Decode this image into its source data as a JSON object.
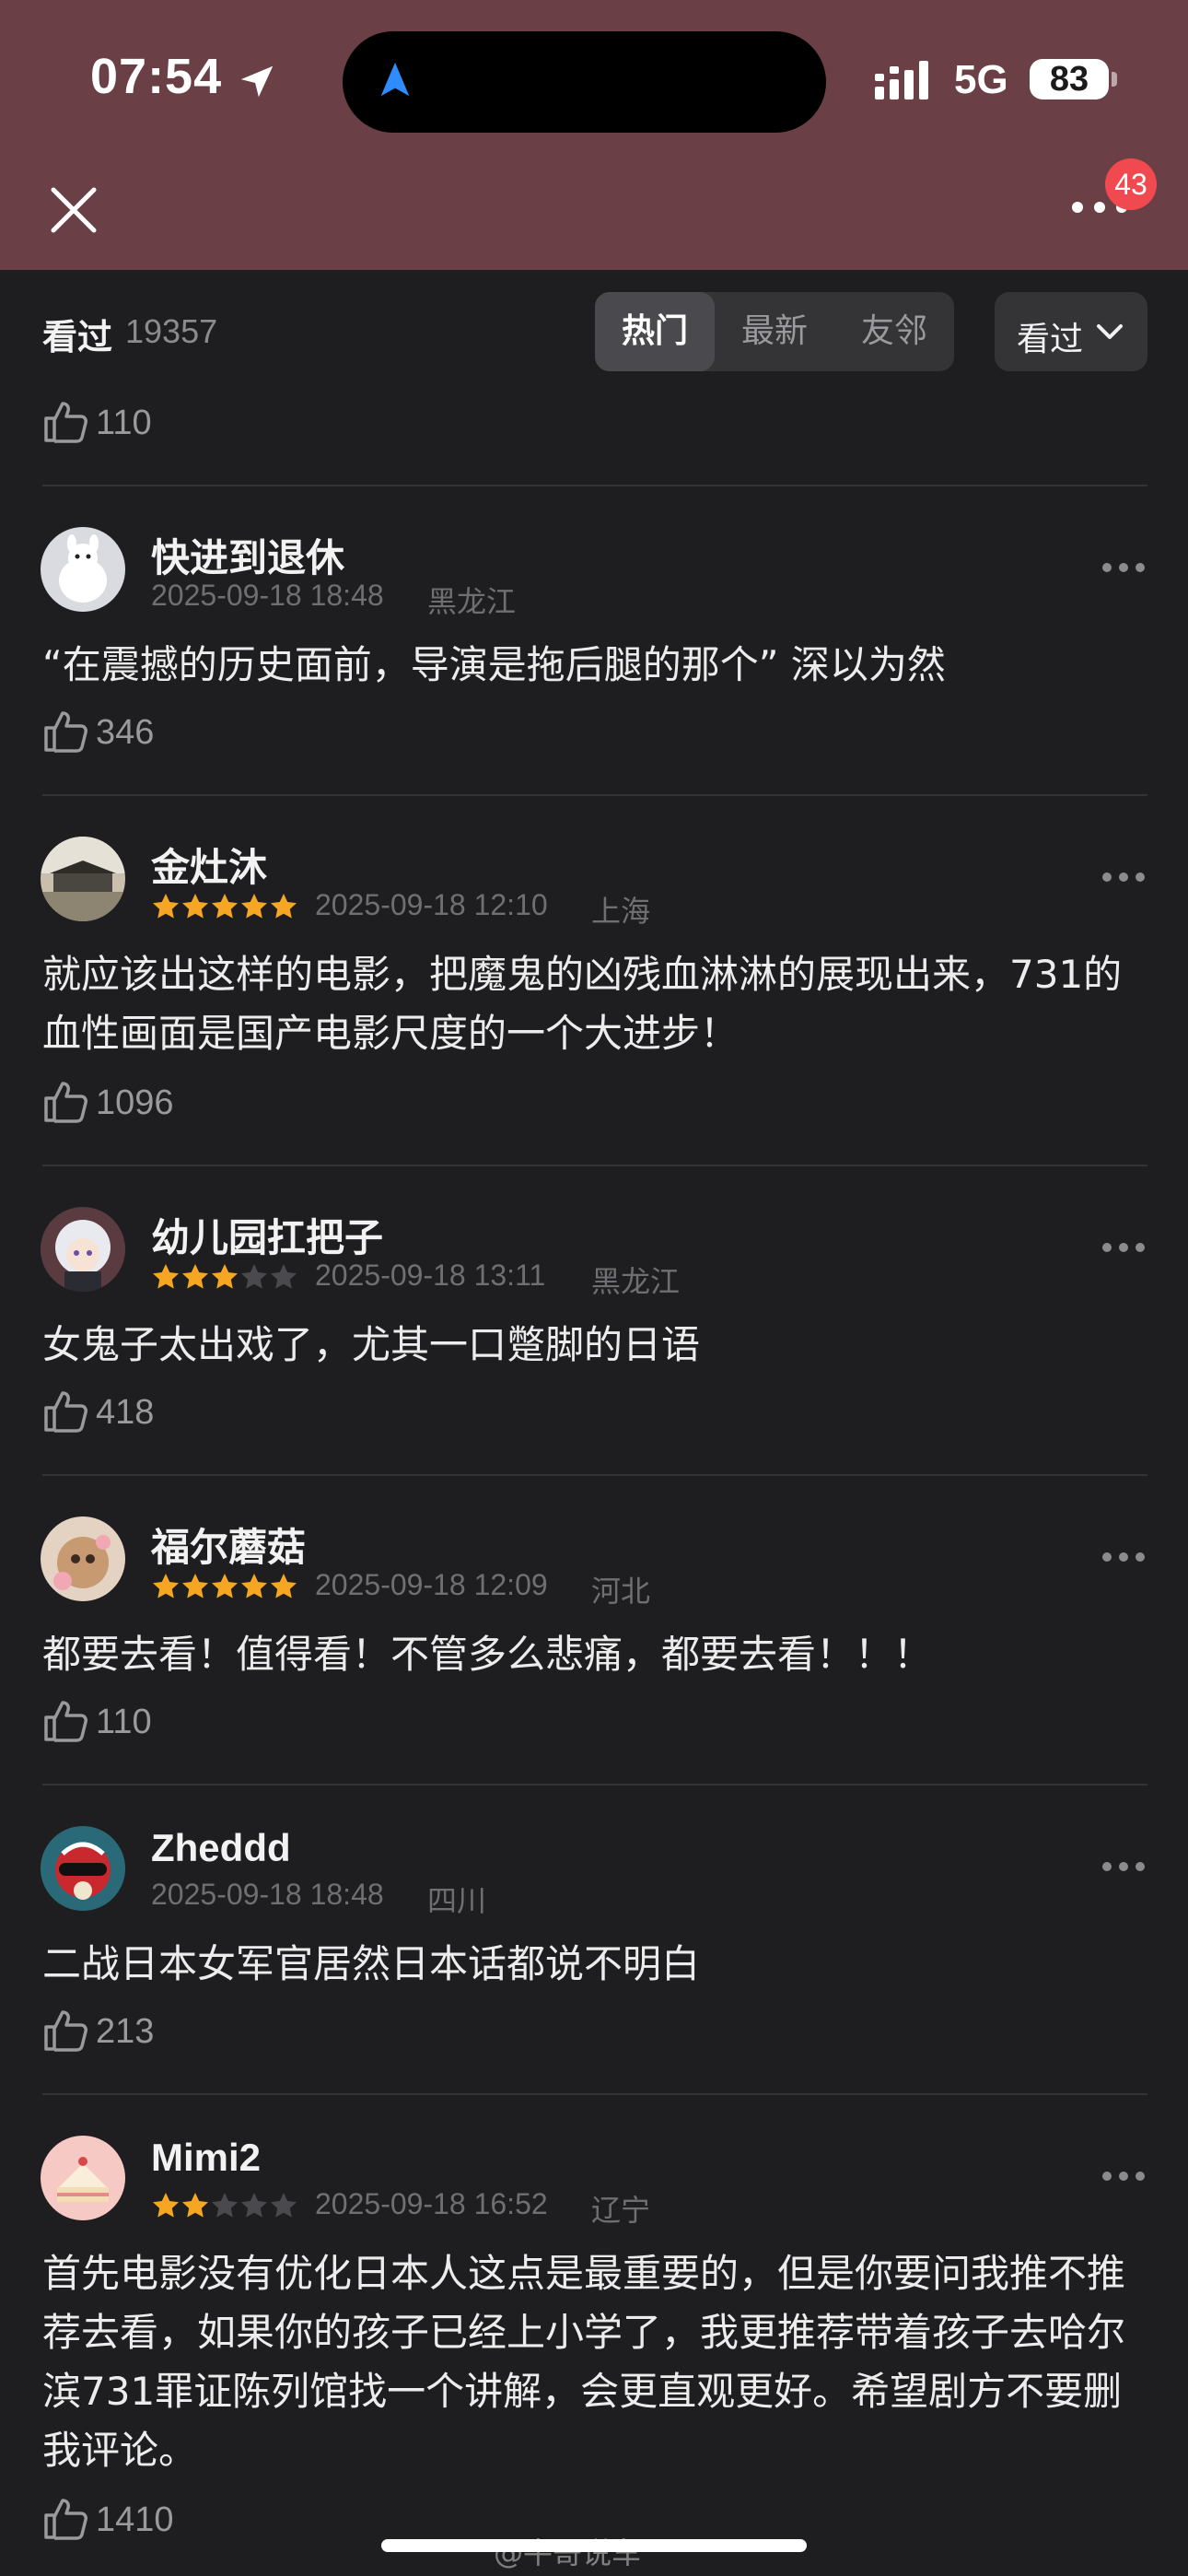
{
  "status_bar": {
    "time": "07:54",
    "network": "5G",
    "battery": "83"
  },
  "nav": {
    "badge_count": "43"
  },
  "filter_bar": {
    "seen_label": "看过",
    "seen_count": "19357",
    "tabs": [
      "热门",
      "最新",
      "友邻"
    ],
    "active_tab": "热门",
    "sort_value": "看过"
  },
  "top_partial_likes": "110",
  "comments": [
    {
      "name": "快进到退休",
      "stars": 0,
      "date": "2025-09-18 18:48",
      "location": "黑龙江",
      "text": "“在震撼的历史面前，导演是拖后腿的那个” 深以为然",
      "likes": "346"
    },
    {
      "name": "金灶沐",
      "stars": 5,
      "date": "2025-09-18 12:10",
      "location": "上海",
      "text": "就应该出这样的电影，把魔鬼的凶残血淋淋的展现出来，731的血性画面是国产电影尺度的一个大进步！",
      "likes": "1096"
    },
    {
      "name": "幼儿园扛把子",
      "stars": 3,
      "date": "2025-09-18 13:11",
      "location": "黑龙江",
      "text": "女鬼子太出戏了，尤其一口蹩脚的日语",
      "likes": "418"
    },
    {
      "name": "福尔蘑菇",
      "stars": 5,
      "date": "2025-09-18 12:09",
      "location": "河北",
      "text": "都要去看！值得看！不管多么悲痛，都要去看！！！",
      "likes": "110"
    },
    {
      "name": "Zheddd",
      "stars": 0,
      "date": "2025-09-18 18:48",
      "location": "四川",
      "text": "二战日本女军官居然日本话都说不明白",
      "likes": "213"
    },
    {
      "name": "Mimi2",
      "stars": 2,
      "date": "2025-09-18 16:52",
      "location": "辽宁",
      "text": "首先电影没有优化日本人这点是最重要的，但是你要问我推不推荐去看，如果你的孩子已经上小学了，我更推荐带着孩子去哈尔滨731罪证陈列馆找一个讲解，会更直观更好。希望剧方不要删我评论。",
      "likes": "1410"
    }
  ],
  "watermark": "@牛哥说车",
  "colors": {
    "header_bg": "#6a3f45",
    "page_bg": "#1e1e20",
    "star_on": "#f5a623",
    "star_off": "#4a4a4e",
    "badge": "#f0494f"
  }
}
